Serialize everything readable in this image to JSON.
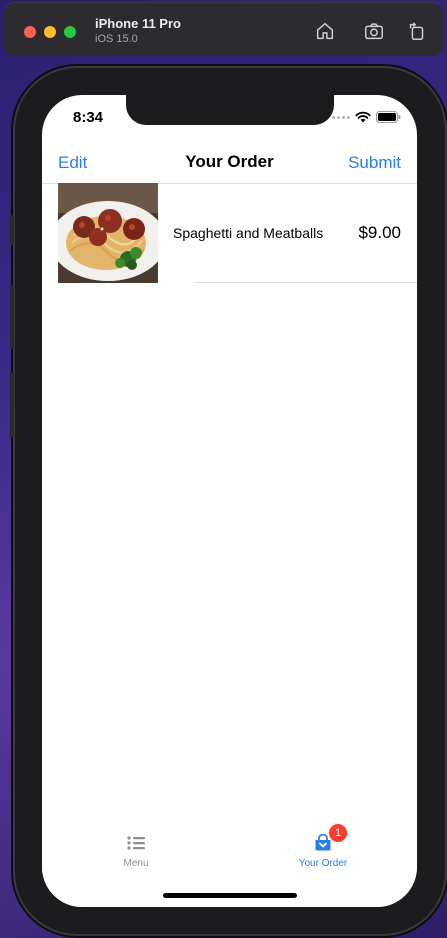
{
  "simulator": {
    "device_name": "iPhone 11 Pro",
    "os_version": "iOS 15.0",
    "buttons": [
      "home-icon",
      "screenshot-icon",
      "rotate-icon"
    ]
  },
  "status_bar": {
    "time": "8:34"
  },
  "nav": {
    "left_button": "Edit",
    "title": "Your Order",
    "right_button": "Submit"
  },
  "order": {
    "items": [
      {
        "name": "Spaghetti and Meatballs",
        "price": "$9.00",
        "image": "spaghetti-meatballs-photo"
      }
    ]
  },
  "tabbar": {
    "tabs": [
      {
        "label": "Menu",
        "icon": "list-icon",
        "selected": false
      },
      {
        "label": "Your Order",
        "icon": "cart-icon",
        "selected": true,
        "badge": "1"
      }
    ]
  },
  "colors": {
    "accent": "#2b7de9",
    "badge": "#ff3b30",
    "inactive": "#8e8e93"
  }
}
